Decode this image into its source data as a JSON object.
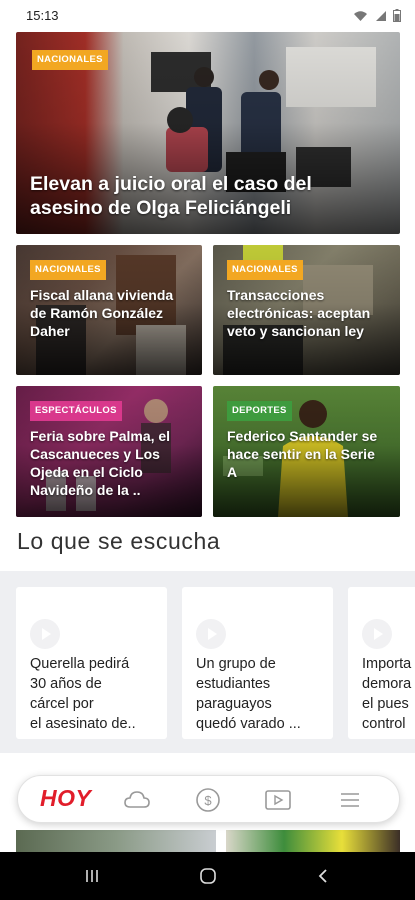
{
  "status_bar": {
    "time": "15:13"
  },
  "hero": {
    "category": "NACIONALES",
    "title": "Elevan a juicio oral el caso del asesino de Olga Feliciángeli"
  },
  "cards": [
    {
      "category": "NACIONALES",
      "title": "Fiscal allana vivienda de Ramón González Daher"
    },
    {
      "category": "NACIONALES",
      "title": "Transacciones electrónicas: aceptan veto y sancionan ley"
    },
    {
      "category": "ESPECTÁCULOS",
      "title": "Feria sobre Palma, el Cascanueces y Los Ojeda en el Ciclo Navideño de la .."
    },
    {
      "category": "DEPORTES",
      "title": "Federico Santander se hace sentir en la Serie A"
    }
  ],
  "section": {
    "title": "Lo que se escucha"
  },
  "podcasts": [
    {
      "title": "Querella pedirá\n30 años de\ncárcel por\nel asesinato de.."
    },
    {
      "title": "Un grupo de\nestudiantes\nparaguayos\nquedó varado ..."
    },
    {
      "title": "Importa\ndemora\nel pues\ncontrol"
    }
  ],
  "bottom_nav": {
    "logo": "HOY",
    "icons": [
      "cloud-icon",
      "dollar-icon",
      "video-icon",
      "menu-icon"
    ]
  },
  "colors": {
    "brand_red": "#e11d2a",
    "badge_orange": "#f2a722",
    "badge_pink": "#d9388c",
    "badge_green": "#3e9b3e"
  }
}
